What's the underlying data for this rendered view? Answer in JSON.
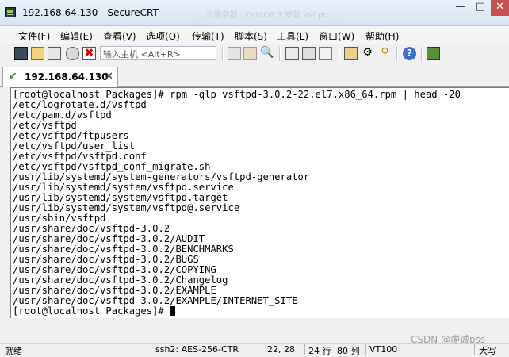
{
  "window": {
    "title": "192.168.64.130 - SecureCRT",
    "faded_title_text": "...云服务器 · CentOS 7 安装 vsftpd ..."
  },
  "menu": [
    "文件(F)",
    "编辑(E)",
    "查看(V)",
    "选项(O)",
    "传输(T)",
    "脚本(S)",
    "工具(L)",
    "窗口(W)",
    "帮助(H)"
  ],
  "toolbar": {
    "command_placeholder": "输入主机 <Alt+R>",
    "icons": [
      "connect-icon",
      "quick-connect-icon",
      "connect-in-tab-icon",
      "reconnect-icon",
      "disconnect-icon",
      "copy-icon",
      "paste-icon",
      "find-icon",
      "print-icon",
      "print-setup-icon",
      "log-icon",
      "session-options-icon",
      "global-options-icon",
      "keymap-icon",
      "help-icon",
      "sftp-icon"
    ]
  },
  "tab": {
    "label": "192.168.64.130"
  },
  "terminal": {
    "lines": [
      "[root@localhost Packages]# rpm -qlp vsftpd-3.0.2-22.el7.x86_64.rpm | head -20",
      "/etc/logrotate.d/vsftpd",
      "/etc/pam.d/vsftpd",
      "/etc/vsftpd",
      "/etc/vsftpd/ftpusers",
      "/etc/vsftpd/user_list",
      "/etc/vsftpd/vsftpd.conf",
      "/etc/vsftpd/vsftpd_conf_migrate.sh",
      "/usr/lib/systemd/system-generators/vsftpd-generator",
      "/usr/lib/systemd/system/vsftpd.service",
      "/usr/lib/systemd/system/vsftpd.target",
      "/usr/lib/systemd/system/vsftpd@.service",
      "/usr/sbin/vsftpd",
      "/usr/share/doc/vsftpd-3.0.2",
      "/usr/share/doc/vsftpd-3.0.2/AUDIT",
      "/usr/share/doc/vsftpd-3.0.2/BENCHMARKS",
      "/usr/share/doc/vsftpd-3.0.2/BUGS",
      "/usr/share/doc/vsftpd-3.0.2/COPYING",
      "/usr/share/doc/vsftpd-3.0.2/Changelog",
      "/usr/share/doc/vsftpd-3.0.2/EXAMPLE",
      "/usr/share/doc/vsftpd-3.0.2/EXAMPLE/INTERNET_SITE"
    ],
    "prompt": "[root@localhost Packages]# "
  },
  "status": {
    "ready": "就绪",
    "cipher": "ssh2: AES-256-CTR",
    "cursor_pos": "22,  28",
    "rows": "24 行",
    "cols": "80 列",
    "term": "VT100",
    "caps": "大写"
  },
  "watermark": "CSDN @虔诚pss"
}
